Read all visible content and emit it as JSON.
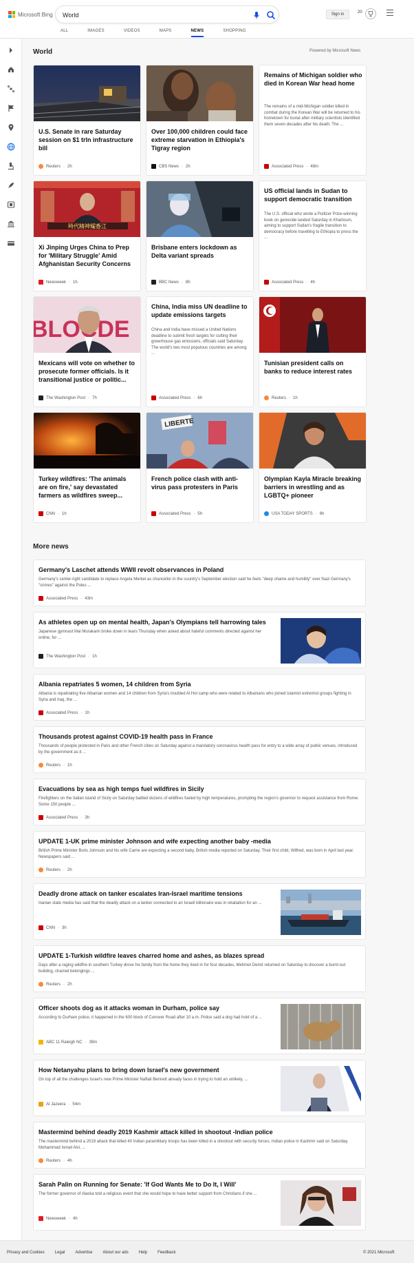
{
  "brand": {
    "name": "Microsoft Bing",
    "colors": [
      "#f25022",
      "#7fba00",
      "#00a4ef",
      "#ffb900"
    ]
  },
  "search": {
    "value": "World"
  },
  "tabs": [
    {
      "label": "ALL"
    },
    {
      "label": "IMAGES"
    },
    {
      "label": "VIDEOS"
    },
    {
      "label": "MAPS"
    },
    {
      "label": "NEWS",
      "active": true
    },
    {
      "label": "SHOPPING"
    }
  ],
  "account": {
    "signin_label": "Sign in",
    "points": "20"
  },
  "rail_icons": [
    "chevron-right-icon",
    "home-icon",
    "satellite-icon",
    "flag-icon",
    "location-icon",
    "globe-icon",
    "microscope-icon",
    "rocket-icon",
    "film-icon",
    "bank-icon",
    "card-icon"
  ],
  "section": {
    "title": "World",
    "powered": "Powered by Microsoft News"
  },
  "top_stories": [
    {
      "title": "U.S. Senate in rare Saturday session on $1 trln infrastructure bill",
      "source": "Reuters",
      "time": "2h",
      "src_color": "#f58a3c"
    },
    {
      "title": "Over 100,000 children could face extreme starvation in Ethiopia's Tigray region",
      "source": "CBS News",
      "time": "2h",
      "src_color": "#111111"
    },
    {
      "title": "Remains of Michigan soldier who died in Korean War head home",
      "snippet": "The remains of a mid-Michigan soldier killed in combat during the Korean War will be returned to his hometown for burial after military scientists identified them seven decades after his death. The ...",
      "source": "Associated Press",
      "time": "48m",
      "src_color": "#cc0000"
    },
    {
      "title": "Xi Jinping Urges China to Prep for 'Military Struggle' Amid Afghanistan Security Concerns",
      "source": "Newsweek",
      "time": "1h",
      "src_color": "#e31b23"
    },
    {
      "title": "Brisbane enters lockdown as Delta variant spreads",
      "source": "BBC News",
      "time": "8h",
      "src_color": "#222222"
    },
    {
      "title": "US official lands in Sudan to support democratic transition",
      "snippet": "The U.S. official who wrote a Pulitzer Prize-winning book on genocide landed Saturday in Khartoum, aiming to support Sudan's fragile transition to democracy before travelling to Ethiopia to press the ...",
      "source": "Associated Press",
      "time": "4h",
      "src_color": "#cc0000"
    },
    {
      "title": "Mexicans will vote on whether to prosecute former officials. Is it transitional justice or politic...",
      "source": "The Washington Post",
      "time": "7h",
      "src_color": "#222222"
    },
    {
      "title": "China, India miss UN deadline to update emissions targets",
      "snippet": "China and India have missed a United Nations deadline to submit fresh targets for cutting their greenhouse gas emissions, officials said Saturday. The world's two most populous countries are among ...",
      "source": "Associated Press",
      "time": "6h",
      "src_color": "#cc0000"
    },
    {
      "title": "Tunisian president calls on banks to reduce interest rates",
      "source": "Reuters",
      "time": "1h",
      "src_color": "#f58a3c"
    },
    {
      "title": "Turkey wildfires: 'The animals are on fire,' say devastated farmers as wildfires sweep...",
      "source": "CNN",
      "time": "1h",
      "src_color": "#cc0000"
    },
    {
      "title": "French police clash with anti-virus pass protesters in Paris",
      "source": "Associated Press",
      "time": "5h",
      "src_color": "#cc0000"
    },
    {
      "title": "Olympian Kayla Miracle breaking barriers in wrestling and as LGBTQ+ pioneer",
      "source": "USA TODAY SPORTS",
      "time": "6h",
      "src_color": "#1e88e5"
    }
  ],
  "image_texts": {
    "xi_banner": "時代精神耀香江",
    "mexico_banner": "BLOCDE",
    "paris_sign": "LIBERTE"
  },
  "more_news": {
    "title": "More news",
    "items": [
      {
        "title": "Germany's Laschet attends WWII revolt observances in Poland",
        "snippet": "Germany's center-right candidate to replace Angela Merkel as chancellor in the country's September election said he feels \"deep shame and humility\" over Nazi Germany's \"crimes\" against the Poles ...",
        "source": "Associated Press",
        "time": "43m",
        "src_color": "#cc0000"
      },
      {
        "title": "As athletes open up on mental health, Japan's Olympians tell harrowing tales",
        "snippet": "Japanese gymnast Mai Murakami broke down in tears Thursday when asked about hateful comments directed against her online, for ...",
        "source": "The Washington Post",
        "time": "1h",
        "src_color": "#222222"
      },
      {
        "title": "Albania repatriates 5 women, 14 children from Syria",
        "snippet": "Albania is repatriating five Albanian women and 14 children from Syria's troubled Al Hol camp who were related to Albanians who joined Islamist extremist groups fighting in Syria and Iraq, the ...",
        "source": "Associated Press",
        "time": "1h",
        "src_color": "#cc0000"
      },
      {
        "title": "Thousands protest against COVID-19 health pass in France",
        "snippet": "Thousands of people protested in Paris and other French cities on Saturday against a mandatory coronavirus health pass for entry to a wide array of public venues, introduced by the government as it ...",
        "source": "Reuters",
        "time": "1h",
        "src_color": "#f58a3c"
      },
      {
        "title": "Evacuations by sea as high temps fuel wildfires in Sicily",
        "snippet": "Firefighters on the Italian island of Sicily on Saturday battled dozens of wildfires fueled by high temperatures, prompting the region's governor to request assistance from Rome. Some 150 people ...",
        "source": "Associated Press",
        "time": "3h",
        "src_color": "#cc0000"
      },
      {
        "title": "UPDATE 1-UK prime minister Johnson and wife expecting another baby -media",
        "snippet": "British Prime Minister Boris Johnson and his wife Carrie are expecting a second baby, British media reported on Saturday. Their first child, Wilfred, was born in April last year. Newspapers said ...",
        "source": "Reuters",
        "time": "2h",
        "src_color": "#f58a3c"
      },
      {
        "title": "Deadly drone attack on tanker escalates Iran-Israel maritime tensions",
        "snippet": "Iranian state media has said that the deadly attack on a tanker connected to an Israeli billionaire was in retaliation for an ...",
        "source": "CNN",
        "time": "3h",
        "src_color": "#cc0000"
      },
      {
        "title": "UPDATE 1-Turkish wildfire leaves charred home and ashes, as blazes spread",
        "snippet": "Days after a raging wildfire in southern Turkey drove his family from the home they lived in for four decades, Mehmet Demir returned on Saturday to discover a burnt-out building, charred belongings ...",
        "source": "Reuters",
        "time": "2h",
        "src_color": "#f58a3c"
      },
      {
        "title": "Officer shoots dog as it attacks woman in Durham, police say",
        "snippet": "According to Durham police, it happened in the 600 block of Conover Road after 10 a.m. Police said a dog had hold of a ...",
        "source": "ABC 11 Raleigh NC",
        "time": "39m",
        "src_color": "#f2b600"
      },
      {
        "title": "How Netanyahu plans to bring down Israel's new government",
        "snippet": "On top of all the challenges Israel's new Prime Minister Naftali Bennett already faces in trying to hold an unlikely, ...",
        "source": "Al Jazeera",
        "time": "54m",
        "src_color": "#e8a317"
      },
      {
        "title": "Mastermind behind deadly 2019 Kashmir attack killed in shootout -Indian police",
        "snippet": "The mastermind behind a 2019 attack that killed 40 Indian paramilitary troops has been killed in a shootout with security forces, Indian police in Kashmir said on Saturday. Mohammad Ismail Alvi, ...",
        "source": "Reuters",
        "time": "4h",
        "src_color": "#f58a3c"
      },
      {
        "title": "Sarah Palin on Running for Senate: 'If God Wants Me to Do It, I Will'",
        "snippet": "The former governor of Alaska told a religious event that she would hope to have better support from Christians if she ...",
        "source": "Newsweek",
        "time": "4h",
        "src_color": "#e31b23"
      }
    ]
  },
  "footer": {
    "links": [
      "Privacy and Cookies",
      "Legal",
      "Advertise",
      "About our ads",
      "Help",
      "Feedback"
    ],
    "copyright": "© 2021 Microsoft"
  }
}
